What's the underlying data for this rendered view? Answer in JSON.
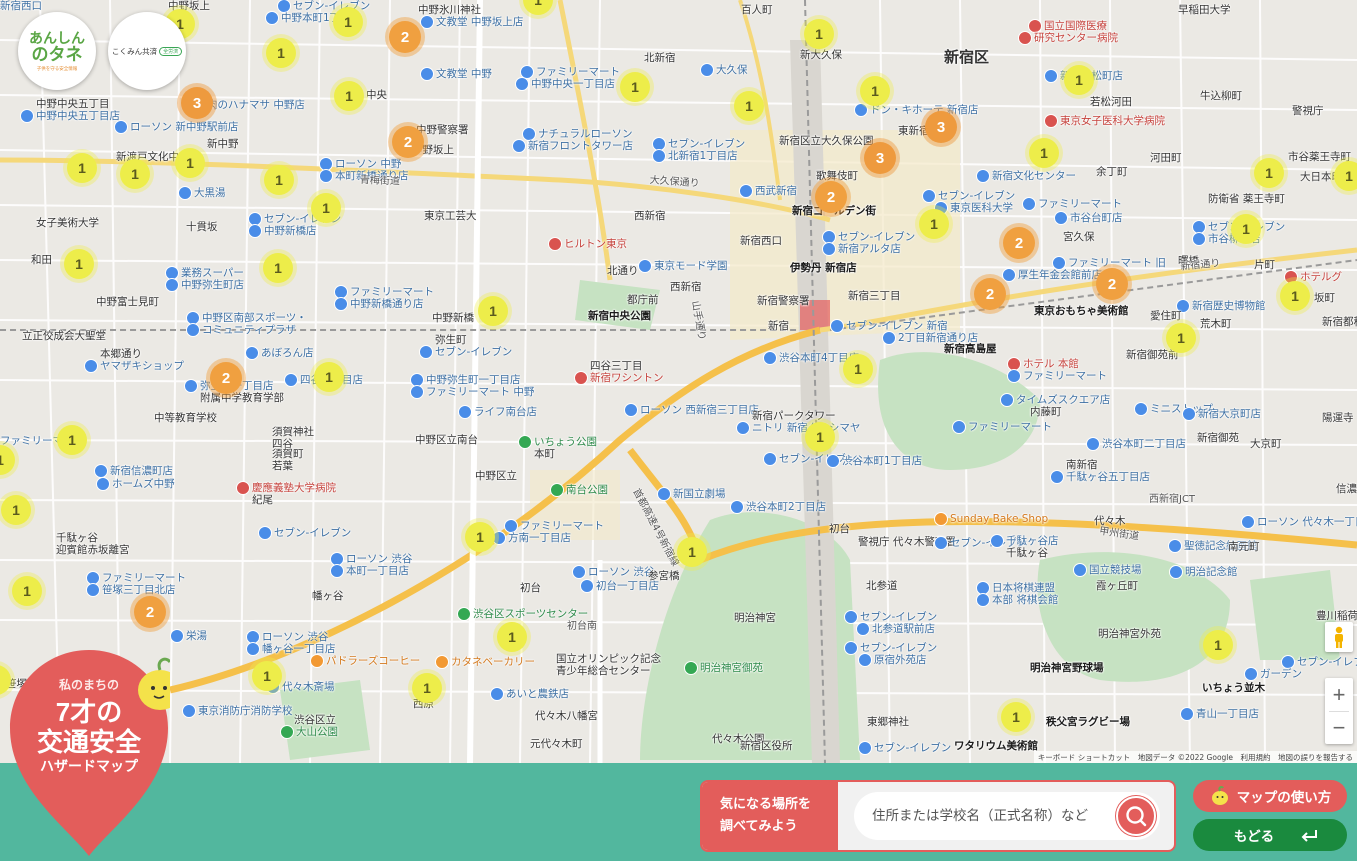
{
  "logos": {
    "anshin": {
      "line1": "あんしん",
      "line2": "のタネ",
      "tagline": "子供を守る安全情報"
    },
    "kokumin": {
      "name": "こくみん共済",
      "badge": "全労済"
    }
  },
  "map": {
    "district_labels": [
      "新宿区"
    ],
    "labels": [
      {
        "t": "セブン-イレブン",
        "c": "blue"
      },
      {
        "t": "中野本町1丁目店",
        "c": "blue"
      },
      {
        "t": "中野坂上",
        "c": "dark"
      },
      {
        "t": "中野氷川神社",
        "c": "dark"
      },
      {
        "t": "文教堂 中野坂上店",
        "c": "blue"
      },
      {
        "t": "百人町",
        "c": "dark"
      },
      {
        "t": "国立国際医療",
        "c": "red"
      },
      {
        "t": "研究センター病院",
        "c": "red"
      },
      {
        "t": "早稲田大学",
        "c": "dark"
      },
      {
        "t": "中野中央五丁目",
        "c": "dark"
      },
      {
        "t": "中野中央五丁目店",
        "c": "blue"
      },
      {
        "t": "文教堂 中野",
        "c": "blue"
      },
      {
        "t": "中央",
        "c": "dark"
      },
      {
        "t": "ファミリーマート",
        "c": "blue"
      },
      {
        "t": "中野中央一丁目店",
        "c": "blue"
      },
      {
        "t": "北新宿",
        "c": "dark"
      },
      {
        "t": "新大久保",
        "c": "dark"
      },
      {
        "t": "大久保",
        "c": "blue"
      },
      {
        "t": "新宿若松町店",
        "c": "blue"
      },
      {
        "t": "若松河田",
        "c": "dark"
      },
      {
        "t": "牛込柳町",
        "c": "dark"
      },
      {
        "t": "警視庁",
        "c": "dark"
      },
      {
        "t": "肉のハナマサ 中野店",
        "c": "blue"
      },
      {
        "t": "中野警察署",
        "c": "dark"
      },
      {
        "t": "ローソン 新中野駅前店",
        "c": "blue"
      },
      {
        "t": "中野坂上",
        "c": "dark"
      },
      {
        "t": "ナチュラルローソン",
        "c": "blue"
      },
      {
        "t": "新宿フロントタワー店",
        "c": "blue"
      },
      {
        "t": "ドン・キホーテ 新宿店",
        "c": "blue"
      },
      {
        "t": "東京女子医科大学病院",
        "c": "red"
      },
      {
        "t": "新中野",
        "c": "dark"
      },
      {
        "t": "新渡戸文化中学校",
        "c": "dark"
      },
      {
        "t": "セブン-イレブン",
        "c": "blue"
      },
      {
        "t": "北新宿1丁目店",
        "c": "blue"
      },
      {
        "t": "新宿区立大久保公園",
        "c": "dark"
      },
      {
        "t": "東新宿",
        "c": "dark"
      },
      {
        "t": "河田町",
        "c": "dark"
      },
      {
        "t": "市谷薬王寺町",
        "c": "dark"
      },
      {
        "t": "ローソン 中野",
        "c": "blue"
      },
      {
        "t": "本町新橋通り店",
        "c": "blue"
      },
      {
        "t": "歌舞伎町",
        "c": "dark"
      },
      {
        "t": "新宿文化センター",
        "c": "blue"
      },
      {
        "t": "余丁町",
        "c": "dark"
      },
      {
        "t": "大日本印刷",
        "c": "dark"
      },
      {
        "t": "大黒湯",
        "c": "blue"
      },
      {
        "t": "西武新宿",
        "c": "blue"
      },
      {
        "t": "セブン-イレブン",
        "c": "blue"
      },
      {
        "t": "東京医科大学",
        "c": "blue"
      },
      {
        "t": "防衛省 薬王寺町",
        "c": "dark"
      },
      {
        "t": "女子美術大学",
        "c": "dark"
      },
      {
        "t": "東京工芸大",
        "c": "dark"
      },
      {
        "t": "新宿ゴールデン街",
        "c": "bold"
      },
      {
        "t": "ファミリーマート",
        "c": "blue"
      },
      {
        "t": "市谷台町店",
        "c": "blue"
      },
      {
        "t": "十貫坂",
        "c": "dark"
      },
      {
        "t": "セブン-イレブン",
        "c": "blue"
      },
      {
        "t": "中野新橋店",
        "c": "blue"
      },
      {
        "t": "西新宿",
        "c": "dark"
      },
      {
        "t": "ヒルトン東京",
        "c": "red"
      },
      {
        "t": "新宿西口",
        "c": "dark"
      },
      {
        "t": "セブン-イレブン",
        "c": "blue"
      },
      {
        "t": "新宿アルタ店",
        "c": "blue"
      },
      {
        "t": "宮久保",
        "c": "dark"
      },
      {
        "t": "セブン-イレブン",
        "c": "blue"
      },
      {
        "t": "市谷柳町店",
        "c": "blue"
      },
      {
        "t": "和田",
        "c": "dark"
      },
      {
        "t": "業務スーパー",
        "c": "blue"
      },
      {
        "t": "中野弥生町店",
        "c": "blue"
      },
      {
        "t": "北通り",
        "c": "dark"
      },
      {
        "t": "東京モード学園",
        "c": "blue"
      },
      {
        "t": "伊勢丹 新宿店",
        "c": "bold"
      },
      {
        "t": "ファミリーマート 旧",
        "c": "blue"
      },
      {
        "t": "厚生年金会館前店",
        "c": "blue"
      },
      {
        "t": "曙橋",
        "c": "dark"
      },
      {
        "t": "片町",
        "c": "dark"
      },
      {
        "t": "ホテルグ",
        "c": "red"
      },
      {
        "t": "中野富士見町",
        "c": "dark"
      },
      {
        "t": "ファミリーマート",
        "c": "blue"
      },
      {
        "t": "中野新橋通り店",
        "c": "blue"
      },
      {
        "t": "西新宿",
        "c": "dark"
      },
      {
        "t": "都庁前",
        "c": "dark"
      },
      {
        "t": "新宿警察署",
        "c": "dark"
      },
      {
        "t": "新宿三丁目",
        "c": "dark"
      },
      {
        "t": "東京おもちゃ美術館",
        "c": "bold"
      },
      {
        "t": "新宿歴史博物館",
        "c": "blue"
      },
      {
        "t": "坂町",
        "c": "dark"
      },
      {
        "t": "中野区南部スポーツ・",
        "c": "blue"
      },
      {
        "t": "コミュニティプラザ",
        "c": "blue"
      },
      {
        "t": "中野新橋",
        "c": "dark"
      },
      {
        "t": "新宿中央公園",
        "c": "bold"
      },
      {
        "t": "新宿都税",
        "c": "dark"
      },
      {
        "t": "新宿",
        "c": "dark"
      },
      {
        "t": "セブン-イレブン 新宿",
        "c": "blue"
      },
      {
        "t": "2丁目新宿通り店",
        "c": "blue"
      },
      {
        "t": "愛住町",
        "c": "dark"
      },
      {
        "t": "荒木町",
        "c": "dark"
      },
      {
        "t": "立正佼成会大聖堂",
        "c": "dark"
      },
      {
        "t": "本郷通り",
        "c": "dark"
      },
      {
        "t": "ヤマザキショップ",
        "c": "blue"
      },
      {
        "t": "あぼろん店",
        "c": "blue"
      },
      {
        "t": "弥生町",
        "c": "dark"
      },
      {
        "t": "セブン-イレブン",
        "c": "blue"
      },
      {
        "t": "渋谷本町4丁目店",
        "c": "blue"
      },
      {
        "t": "新宿高島屋",
        "c": "bold"
      },
      {
        "t": "新宿御苑前",
        "c": "dark"
      },
      {
        "t": "四谷三丁目",
        "c": "dark"
      },
      {
        "t": "新宿ワシントン",
        "c": "red"
      },
      {
        "t": "ホテル 本館",
        "c": "red"
      },
      {
        "t": "ファミリーマート",
        "c": "blue"
      },
      {
        "t": "四谷四丁目店",
        "c": "blue"
      },
      {
        "t": "中野弥生町一丁目店",
        "c": "blue"
      },
      {
        "t": "ファミリーマート 中野",
        "c": "blue"
      },
      {
        "t": "弥生町一丁目店",
        "c": "blue"
      },
      {
        "t": "附属中学教育学部",
        "c": "dark"
      },
      {
        "t": "中等教育学校",
        "c": "dark"
      },
      {
        "t": "ライフ南台店",
        "c": "blue"
      },
      {
        "t": "ローソン 西新宿三丁目店",
        "c": "blue"
      },
      {
        "t": "新宿パークタワー",
        "c": "dark"
      },
      {
        "t": "ニトリ 新宿タカシマヤ",
        "c": "blue"
      },
      {
        "t": "タイムズスクエア店",
        "c": "blue"
      },
      {
        "t": "内藤町",
        "c": "dark"
      },
      {
        "t": "ミニストップ",
        "c": "blue"
      },
      {
        "t": "新宿大京町店",
        "c": "blue"
      },
      {
        "t": "陽運寺",
        "c": "dark"
      },
      {
        "t": "須賀神社",
        "c": "dark"
      },
      {
        "t": "四谷",
        "c": "dark"
      },
      {
        "t": "中野区立南台",
        "c": "dark"
      },
      {
        "t": "いちょう公園",
        "c": "green"
      },
      {
        "t": "本町",
        "c": "dark"
      },
      {
        "t": "ファミリーマート",
        "c": "blue"
      },
      {
        "t": "渋谷本町二丁目店",
        "c": "blue"
      },
      {
        "t": "新宿御苑",
        "c": "dark"
      },
      {
        "t": "大京町",
        "c": "dark"
      },
      {
        "t": "須賀町",
        "c": "dark"
      },
      {
        "t": "若葉",
        "c": "dark"
      },
      {
        "t": "セブン-イレブン",
        "c": "blue"
      },
      {
        "t": "渋谷本町1丁目店",
        "c": "blue"
      },
      {
        "t": "南新宿",
        "c": "dark"
      },
      {
        "t": "千駄ヶ谷五丁目店",
        "c": "blue"
      },
      {
        "t": "ファミリーマート",
        "c": "blue"
      },
      {
        "t": "新宿信濃町店",
        "c": "blue"
      },
      {
        "t": "ホームズ中野",
        "c": "blue"
      },
      {
        "t": "中野区立",
        "c": "dark"
      },
      {
        "t": "南台公園",
        "c": "green"
      },
      {
        "t": "新国立劇場",
        "c": "blue"
      },
      {
        "t": "西新宿JCT",
        "c": "road"
      },
      {
        "t": "代々木",
        "c": "dark"
      },
      {
        "t": "信濃町",
        "c": "dark"
      },
      {
        "t": "慶應義塾大学病院",
        "c": "red"
      },
      {
        "t": "紀尾",
        "c": "dark"
      },
      {
        "t": "セブン-イレブン",
        "c": "blue"
      },
      {
        "t": "渋谷本町2丁目店",
        "c": "blue"
      },
      {
        "t": "Sunday Bake Shop",
        "c": "orange"
      },
      {
        "t": "ローソン 代々木一丁目店",
        "c": "blue"
      },
      {
        "t": "千駄ヶ谷",
        "c": "dark"
      },
      {
        "t": "迎賓館赤坂離宮",
        "c": "dark"
      },
      {
        "t": "ファミリーマート",
        "c": "blue"
      },
      {
        "t": "方南一丁目店",
        "c": "blue"
      },
      {
        "t": "初台",
        "c": "dark"
      },
      {
        "t": "警視庁 代々木警察署",
        "c": "dark"
      },
      {
        "t": "セブン-イレブン",
        "c": "blue"
      },
      {
        "t": "千駄ヶ谷店",
        "c": "blue"
      },
      {
        "t": "千駄ヶ谷",
        "c": "dark"
      },
      {
        "t": "国立競技場",
        "c": "blue"
      },
      {
        "t": "聖徳記念絵画館",
        "c": "blue"
      },
      {
        "t": "南元町",
        "c": "dark"
      },
      {
        "t": "ローソン 渋谷",
        "c": "blue"
      },
      {
        "t": "本町一丁目店",
        "c": "blue"
      },
      {
        "t": "ローソン 渋谷",
        "c": "blue"
      },
      {
        "t": "初台一丁目店",
        "c": "blue"
      },
      {
        "t": "参宮橋",
        "c": "dark"
      },
      {
        "t": "北参道",
        "c": "dark"
      },
      {
        "t": "明治記念館",
        "c": "blue"
      },
      {
        "t": "ファミリーマート",
        "c": "blue"
      },
      {
        "t": "笹塚三丁目北店",
        "c": "blue"
      },
      {
        "t": "幡ヶ谷",
        "c": "dark"
      },
      {
        "t": "初台",
        "c": "dark"
      },
      {
        "t": "日本将棋連盟",
        "c": "blue"
      },
      {
        "t": "本部 将棋会館",
        "c": "blue"
      },
      {
        "t": "霞ヶ丘町",
        "c": "dark"
      },
      {
        "t": "明治神宮",
        "c": "dark"
      },
      {
        "t": "セブン-イレブン",
        "c": "blue"
      },
      {
        "t": "北参道駅前店",
        "c": "blue"
      },
      {
        "t": "明治神宮外苑",
        "c": "dark"
      },
      {
        "t": "豊川稲荷",
        "c": "dark"
      },
      {
        "t": "栄湯",
        "c": "blue"
      },
      {
        "t": "ローソン 渋谷",
        "c": "blue"
      },
      {
        "t": "幡ヶ谷一丁目店",
        "c": "blue"
      },
      {
        "t": "渋谷区スポーツセンター",
        "c": "green"
      },
      {
        "t": "初台南",
        "c": "road"
      },
      {
        "t": "国立オリンピック記念",
        "c": "dark"
      },
      {
        "t": "青少年総合センター",
        "c": "dark"
      },
      {
        "t": "明治神宮御苑",
        "c": "green"
      },
      {
        "t": "セブン-イレブン",
        "c": "blue"
      },
      {
        "t": "原宿外苑店",
        "c": "blue"
      },
      {
        "t": "明治神宮野球場",
        "c": "bold"
      },
      {
        "t": "パドラーズコーヒー",
        "c": "orange"
      },
      {
        "t": "カタネベーカリー",
        "c": "orange"
      },
      {
        "t": "いちょう並木",
        "c": "bold"
      },
      {
        "t": "セブン-イレブン 南",
        "c": "blue"
      },
      {
        "t": "ガーデン",
        "c": "blue"
      },
      {
        "t": "笹塚",
        "c": "dark"
      },
      {
        "t": "代々木斎場",
        "c": "blue"
      },
      {
        "t": "あいと農鉄店",
        "c": "blue"
      },
      {
        "t": "青山一丁目店",
        "c": "blue"
      },
      {
        "t": "東京消防庁消防学校",
        "c": "blue"
      },
      {
        "t": "西原",
        "c": "dark"
      },
      {
        "t": "代々木八幡宮",
        "c": "dark"
      },
      {
        "t": "東郷神社",
        "c": "dark"
      },
      {
        "t": "秩父宮ラグビー場",
        "c": "bold"
      },
      {
        "t": "渋谷区立",
        "c": "dark"
      },
      {
        "t": "大山公園",
        "c": "green"
      },
      {
        "t": "元代々木町",
        "c": "dark"
      },
      {
        "t": "代々木公園",
        "c": "dark"
      },
      {
        "t": "ワタリウム美術館",
        "c": "bold"
      },
      {
        "t": "セブン-イレブン",
        "c": "blue"
      },
      {
        "t": "新宿区役所",
        "c": "dark"
      },
      {
        "t": "新宿西口",
        "c": "blue"
      }
    ],
    "road_labels": [
      "首都高速4号新宿線",
      "甲州街道",
      "山手通り",
      "青梅街道",
      "大久保通り",
      "新宿通り"
    ],
    "clusters": [
      {
        "n": "1"
      },
      {
        "n": "1"
      },
      {
        "n": "2"
      },
      {
        "n": "1"
      },
      {
        "n": "1"
      },
      {
        "n": "1"
      },
      {
        "n": "3"
      },
      {
        "n": "1"
      },
      {
        "n": "2"
      },
      {
        "n": "1"
      },
      {
        "n": "1"
      },
      {
        "n": "3"
      },
      {
        "n": "1"
      },
      {
        "n": "1"
      },
      {
        "n": "1"
      },
      {
        "n": "1"
      },
      {
        "n": "1"
      },
      {
        "n": "3"
      },
      {
        "n": "1"
      },
      {
        "n": "1"
      },
      {
        "n": "2"
      },
      {
        "n": "1"
      },
      {
        "n": "1"
      },
      {
        "n": "2"
      },
      {
        "n": "1"
      },
      {
        "n": "1"
      },
      {
        "n": "2"
      },
      {
        "n": "2"
      },
      {
        "n": "1"
      },
      {
        "n": "1"
      },
      {
        "n": "1"
      },
      {
        "n": "1"
      },
      {
        "n": "1"
      },
      {
        "n": "2"
      },
      {
        "n": "1"
      },
      {
        "n": "1"
      },
      {
        "n": "1"
      },
      {
        "n": "1"
      },
      {
        "n": "1"
      },
      {
        "n": "1"
      },
      {
        "n": "1"
      },
      {
        "n": "2"
      },
      {
        "n": "1"
      },
      {
        "n": "1"
      },
      {
        "n": "1"
      },
      {
        "n": "1"
      },
      {
        "n": "1"
      },
      {
        "n": "1"
      },
      {
        "n": "1"
      },
      {
        "n": "1"
      },
      {
        "n": "1"
      }
    ],
    "attribution": "キーボード ショートカット　地図データ ©2022 Google　利用規約　地図の誤りを報告する",
    "controls": {
      "zoom_in": "+",
      "zoom_out": "−"
    }
  },
  "hazard_badge": {
    "line1": "私のまちの",
    "line2": "7才の",
    "line3": "交通安全",
    "line4": "ハザードマップ"
  },
  "footer": {
    "search_label_line1": "気になる場所を",
    "search_label_line2": "調べてみよう",
    "search_placeholder": "住所または学校名（正式名称）など",
    "howto_button": "マップの使い方",
    "back_button": "もどる"
  },
  "colors": {
    "footer_bg": "#52b79e",
    "accent_red": "#e35d5b",
    "back_green": "#1a8a3e",
    "cluster_1": "#eded4a",
    "cluster_2plus": "#f0a040"
  }
}
